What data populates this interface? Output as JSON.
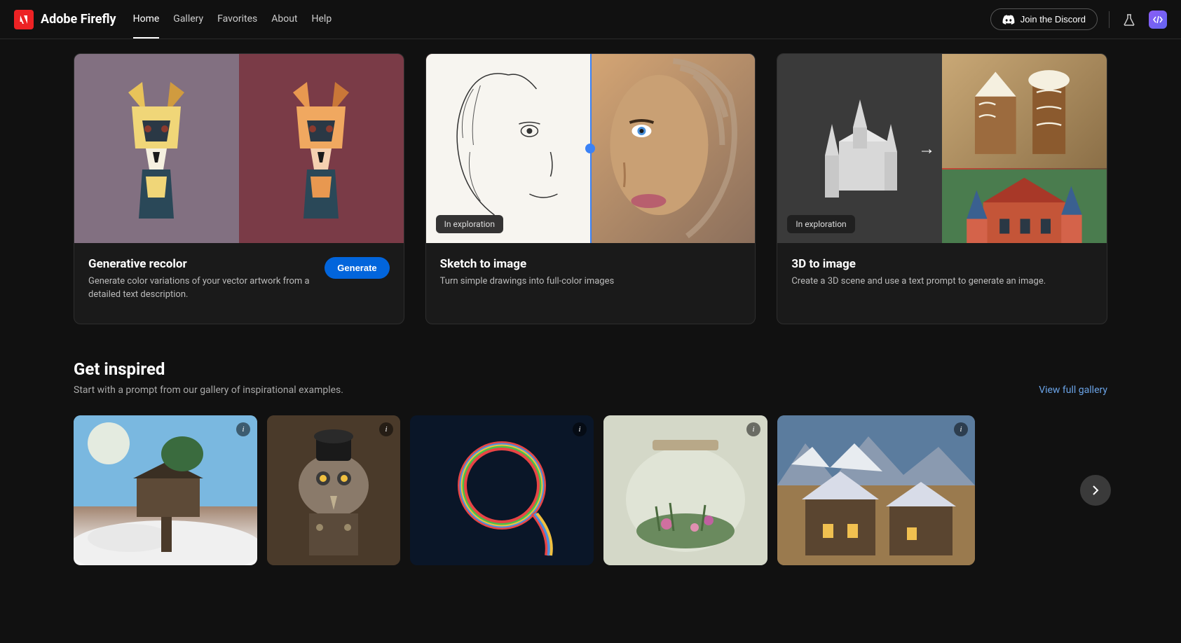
{
  "header": {
    "brand": "Adobe Firefly",
    "nav": {
      "home": "Home",
      "gallery": "Gallery",
      "favorites": "Favorites",
      "about": "About",
      "help": "Help"
    },
    "discord_label": "Join the Discord"
  },
  "features": [
    {
      "title": "Generative recolor",
      "desc": "Generate color variations of your vector artwork from a detailed text description.",
      "cta": "Generate",
      "badge": null
    },
    {
      "title": "Sketch to image",
      "desc": "Turn simple drawings into full-color images",
      "cta": null,
      "badge": "In exploration"
    },
    {
      "title": "3D to image",
      "desc": "Create a 3D scene and use a text prompt to generate an image.",
      "cta": null,
      "badge": "In exploration"
    }
  ],
  "inspire": {
    "title": "Get inspired",
    "subtitle": "Start with a prompt from our gallery of inspirational examples.",
    "view_link": "View full gallery"
  }
}
